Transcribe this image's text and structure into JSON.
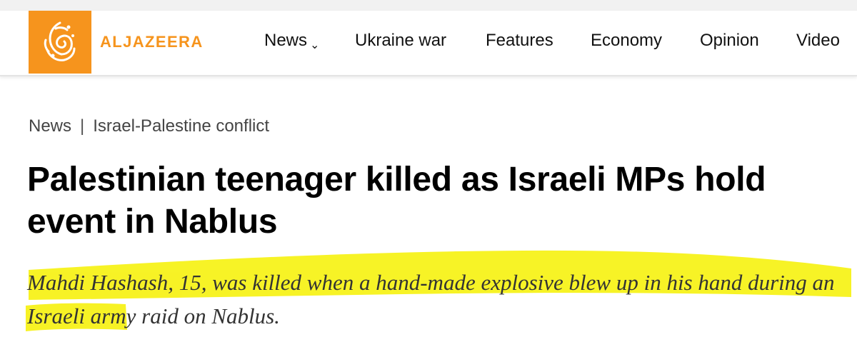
{
  "brand": {
    "name": "ALJAZEERA",
    "logo_icon": "aljazeera-calligraphy-logo-icon",
    "brand_color": "#f6941d"
  },
  "nav": {
    "items": [
      {
        "label": "News"
      },
      {
        "label": "Ukraine war"
      },
      {
        "label": "Features"
      },
      {
        "label": "Economy"
      },
      {
        "label": "Opinion"
      },
      {
        "label": "Video"
      }
    ],
    "dropdown_icon": "chevron-down-icon"
  },
  "breadcrumb": {
    "section": "News",
    "separator": "|",
    "topic": "Israel-Palestine conflict"
  },
  "article": {
    "headline": "Palestinian teenager killed as Israeli MPs hold event in Nablus",
    "subhead": "Mahdi Hashash, 15, was killed when a hand-made explosive blew up in his hand during an Israeli army raid on Nablus.",
    "highlight_color": "#f7f21a"
  }
}
